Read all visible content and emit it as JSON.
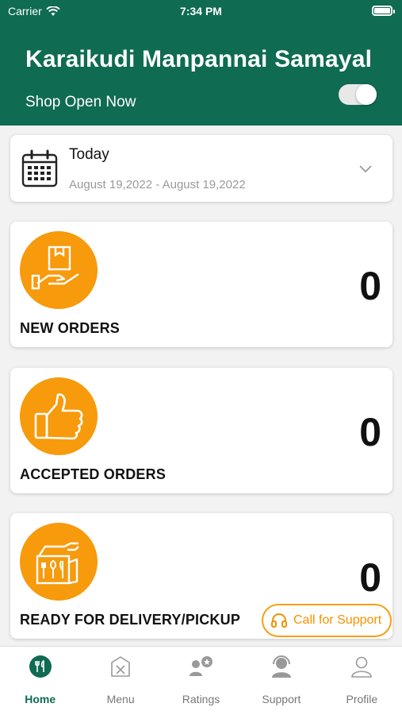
{
  "status_bar": {
    "carrier": "Carrier",
    "time": "7:34 PM"
  },
  "header": {
    "shop_name": "Karaikudi Manpannai Samayal",
    "shop_status": "Shop Open Now",
    "shop_open": true
  },
  "date_filter": {
    "label": "Today",
    "range": "August 19,2022 - August 19,2022"
  },
  "orders": [
    {
      "label": "NEW ORDERS",
      "count": "0",
      "icon": "box-hand-icon"
    },
    {
      "label": "ACCEPTED ORDERS",
      "count": "0",
      "icon": "thumbs-up-icon"
    },
    {
      "label": "READY FOR DELIVERY/PICKUP",
      "count": "0",
      "icon": "delivery-bag-icon"
    }
  ],
  "support_button": {
    "label": "Call for Support",
    "icon": "headphones-icon"
  },
  "tabs": [
    {
      "label": "Home",
      "icon": "home-utensils-icon",
      "active": true
    },
    {
      "label": "Menu",
      "icon": "menu-icon",
      "active": false
    },
    {
      "label": "Ratings",
      "icon": "ratings-icon",
      "active": false
    },
    {
      "label": "Support",
      "icon": "support-agent-icon",
      "active": false
    },
    {
      "label": "Profile",
      "icon": "profile-icon",
      "active": false
    }
  ],
  "colors": {
    "primary": "#0f6b52",
    "accent": "#f79a0c",
    "background": "#f2f2f2"
  }
}
